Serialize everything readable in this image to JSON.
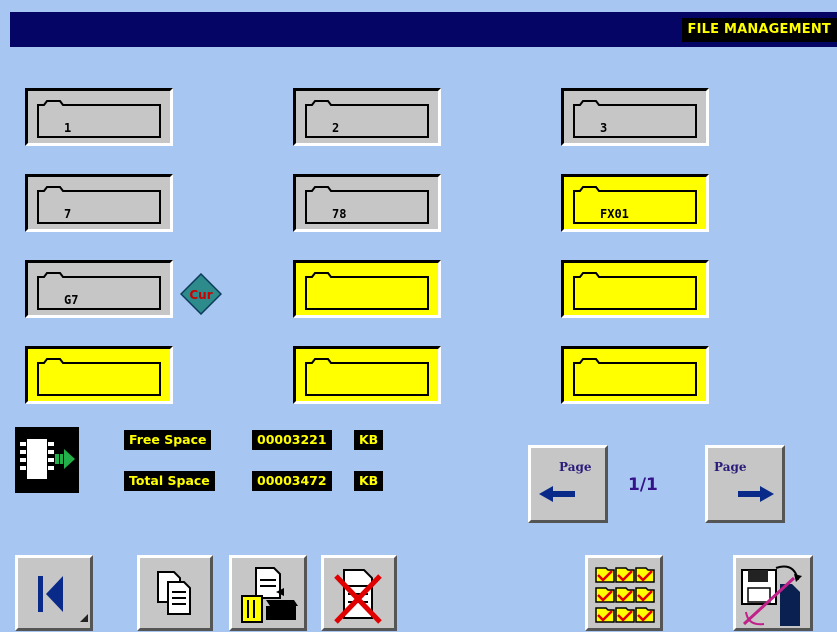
{
  "header": {
    "title": "FILE MANAGEMENT"
  },
  "folders": [
    {
      "label": "1",
      "state": "gray"
    },
    {
      "label": "2",
      "state": "gray"
    },
    {
      "label": "3",
      "state": "gray"
    },
    {
      "label": "7",
      "state": "gray"
    },
    {
      "label": "78",
      "state": "gray"
    },
    {
      "label": "FX01",
      "state": "yellow"
    },
    {
      "label": "G7",
      "state": "gray",
      "current": true
    },
    {
      "label": "",
      "state": "yellow"
    },
    {
      "label": "",
      "state": "yellow"
    },
    {
      "label": "",
      "state": "yellow"
    },
    {
      "label": "",
      "state": "yellow"
    },
    {
      "label": "",
      "state": "yellow"
    }
  ],
  "current_marker": "Cur",
  "storage": {
    "free_label": "Free Space",
    "free_value": "00003221",
    "total_label": "Total Space",
    "total_value": "00003472",
    "unit": "KB"
  },
  "pagination": {
    "prev_label": "Page",
    "next_label": "Page",
    "current": "1/1"
  },
  "toolbar": [
    {
      "name": "first-page-button",
      "icon": "skip-back-icon"
    },
    {
      "name": "copy-button",
      "icon": "copy-icon"
    },
    {
      "name": "backup-button",
      "icon": "file-transfer-icon"
    },
    {
      "name": "delete-button",
      "icon": "delete-file-icon"
    },
    {
      "name": "select-all-button",
      "icon": "select-all-icon"
    },
    {
      "name": "save-button",
      "icon": "save-disk-icon"
    }
  ],
  "colors": {
    "background": "#a7c7f2",
    "header": "#050566",
    "title_text": "#ffff00",
    "folder_used": "#c6c6c6",
    "folder_empty": "#ffff00",
    "cur_marker": "#2e8b8b",
    "cur_text": "#cc0000"
  }
}
